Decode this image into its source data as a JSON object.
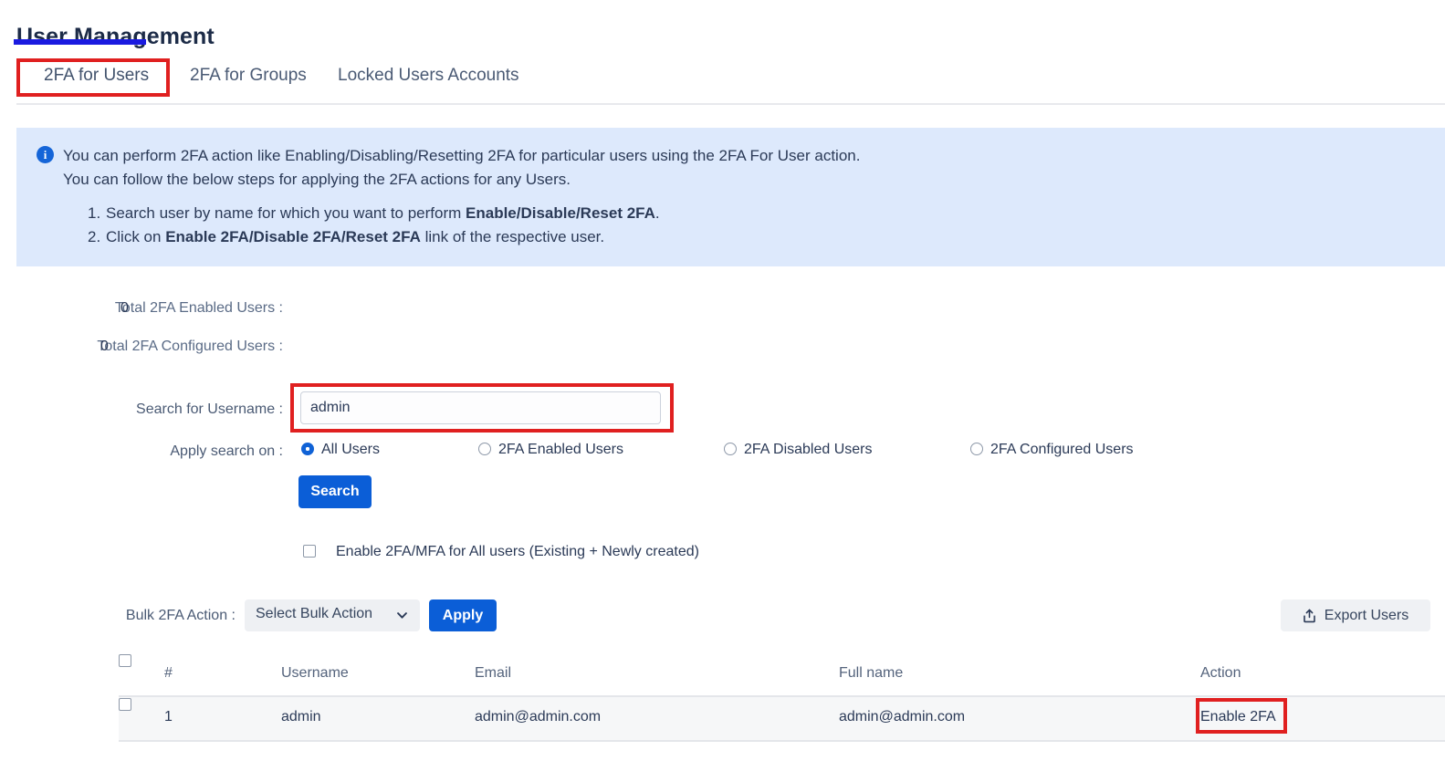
{
  "page": {
    "title": "User Management"
  },
  "tabs": [
    {
      "label": "2FA for Users",
      "active": true
    },
    {
      "label": "2FA for Groups",
      "active": false
    },
    {
      "label": "Locked Users Accounts",
      "active": false
    }
  ],
  "info_banner": {
    "icon": "info-icon",
    "line1": "You can perform 2FA action like Enabling/Disabling/Resetting 2FA for particular users using the 2FA For User action.",
    "line2": "You can follow the below steps for applying the 2FA actions for any Users.",
    "steps": [
      {
        "number": "1.",
        "pre": "Search user by name for which you want to perform ",
        "strong": "Enable/Disable/Reset 2FA",
        "post": "."
      },
      {
        "number": "2.",
        "pre": "Click on ",
        "strong": "Enable 2FA/Disable 2FA/Reset 2FA",
        "post": " link of the respective user."
      }
    ]
  },
  "stats": {
    "enabled_label": "Total 2FA Enabled Users :",
    "enabled_value": "0",
    "configured_label": "Total 2FA Configured Users :",
    "configured_value": "0"
  },
  "search": {
    "label": "Search for Username :",
    "value": "admin",
    "placeholder": "",
    "button_label": "Search",
    "apply_label": "Apply search on :",
    "options": [
      {
        "label": "All Users",
        "selected": true
      },
      {
        "label": "2FA Enabled Users",
        "selected": false
      },
      {
        "label": "2FA Disabled Users",
        "selected": false
      },
      {
        "label": "2FA Configured Users",
        "selected": false
      }
    ]
  },
  "enable_all": {
    "label": "Enable 2FA/MFA for All users (Existing + Newly created)",
    "checked": false
  },
  "bulk": {
    "label": "Bulk 2FA Action :",
    "selected_option": "Select Bulk Action",
    "apply_label": "Apply"
  },
  "export": {
    "label": "Export Users",
    "icon": "export-upload-icon"
  },
  "table": {
    "columns": [
      "#",
      "Username",
      "Email",
      "Full name",
      "Action"
    ],
    "rows": [
      {
        "num": "1",
        "username": "admin",
        "email": "admin@admin.com",
        "fullname": "admin@admin.com",
        "action": "Enable 2FA"
      }
    ]
  },
  "annotations": {
    "accent_red": "#e02020",
    "tab_underline": "#1a1ae0",
    "primary_blue": "#0b5ed7"
  }
}
